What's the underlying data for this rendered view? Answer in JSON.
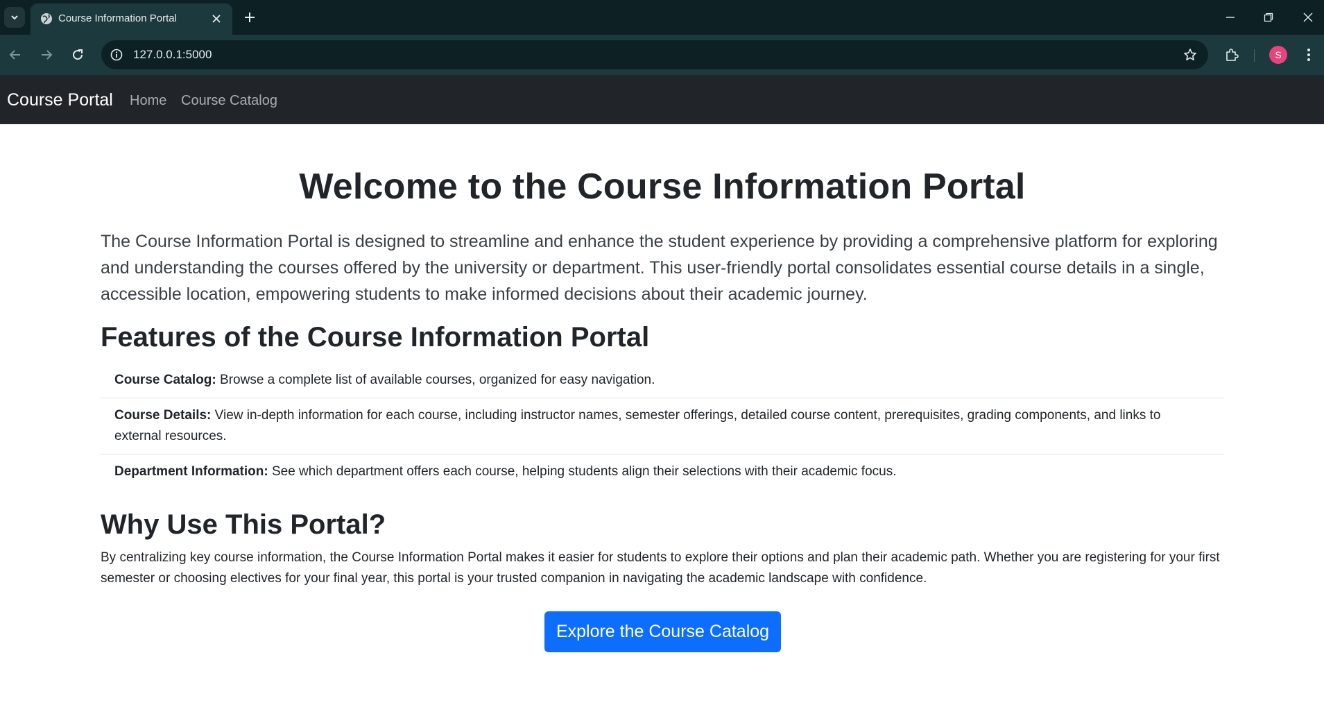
{
  "browser": {
    "tab_title": "Course Information Portal",
    "url": "127.0.0.1:5000",
    "profile_initial": "S"
  },
  "navbar": {
    "brand": "Course Portal",
    "links": [
      "Home",
      "Course Catalog"
    ]
  },
  "main": {
    "title": "Welcome to the Course Information Portal",
    "lead": "The Course Information Portal is designed to streamline and enhance the student experience by providing a comprehensive platform for exploring and understanding the courses offered by the university or department. This user-friendly portal consolidates essential course details in a single, accessible location, empowering students to make informed decisions about their academic journey.",
    "features_heading": "Features of the Course Information Portal",
    "features": [
      {
        "label": "Course Catalog:",
        "text": " Browse a complete list of available courses, organized for easy navigation."
      },
      {
        "label": "Course Details:",
        "text": " View in-depth information for each course, including instructor names, semester offerings, detailed course content, prerequisites, grading components, and links to external resources."
      },
      {
        "label": "Department Information:",
        "text": " See which department offers each course, helping students align their selections with their academic focus."
      }
    ],
    "why_heading": "Why Use This Portal?",
    "why_text": "By centralizing key course information, the Course Information Portal makes it easier for students to explore their options and plan their academic path. Whether you are registering for your first semester or choosing electives for your final year, this portal is your trusted companion in navigating the academic landscape with confidence.",
    "cta_label": "Explore the Course Catalog"
  },
  "colors": {
    "navbar_bg": "#212529",
    "primary": "#0d6efd",
    "chrome_bg": "#0d2125",
    "toolbar_bg": "#1c3a3d"
  }
}
